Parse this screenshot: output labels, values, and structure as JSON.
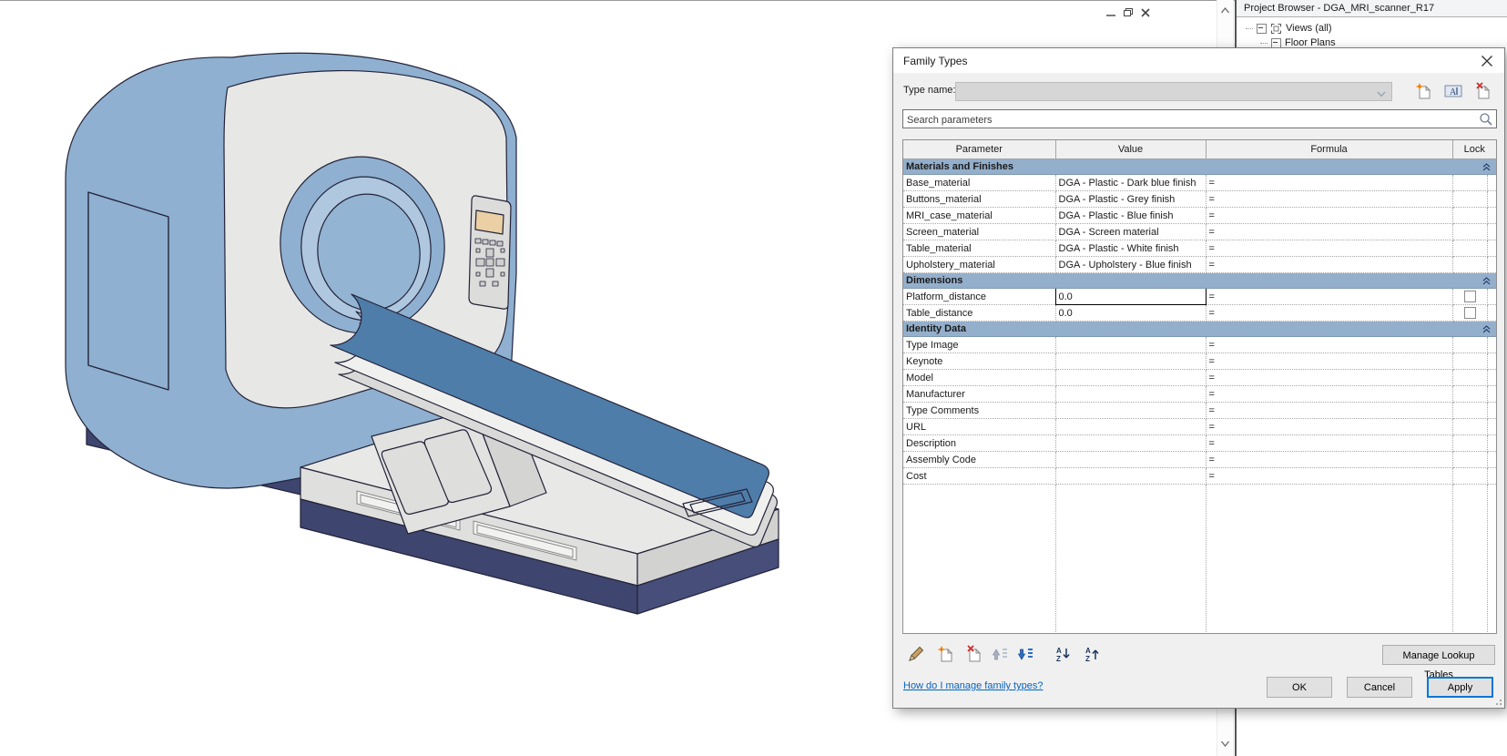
{
  "window_controls": {
    "buttons": [
      "minimize",
      "restore",
      "close"
    ]
  },
  "project_browser": {
    "title": "Project Browser - DGA_MRI_scanner_R17",
    "items": [
      {
        "label": "Views (all)",
        "level": 0,
        "icon": "views-icon",
        "expand": "expanded"
      },
      {
        "label": "Floor Plans",
        "level": 1,
        "icon": null,
        "expand": "expanded"
      }
    ]
  },
  "family_types_dialog": {
    "title": "Family Types",
    "type_name": {
      "label": "Type name:",
      "value": ""
    },
    "type_actions": [
      "new-type",
      "rename-type",
      "delete-type"
    ],
    "search": {
      "placeholder": "Search parameters"
    },
    "table": {
      "columns": [
        "Parameter",
        "Value",
        "Formula",
        "Lock"
      ],
      "groups": [
        {
          "name": "Materials and Finishes",
          "rows": [
            {
              "parameter": "Base_material",
              "value": "DGA - Plastic - Dark blue finish",
              "formula": "="
            },
            {
              "parameter": "Buttons_material",
              "value": "DGA - Plastic - Grey finish",
              "formula": "="
            },
            {
              "parameter": "MRI_case_material",
              "value": "DGA - Plastic - Blue finish",
              "formula": "="
            },
            {
              "parameter": "Screen_material",
              "value": "DGA - Screen material",
              "formula": "="
            },
            {
              "parameter": "Table_material",
              "value": "DGA - Plastic - White finish",
              "formula": "="
            },
            {
              "parameter": "Upholstery_material",
              "value": "DGA - Upholstery - Blue finish",
              "formula": "="
            }
          ]
        },
        {
          "name": "Dimensions",
          "rows": [
            {
              "parameter": "Platform_distance",
              "value": "0.0",
              "formula": "=",
              "lock": "unchecked",
              "editing": true
            },
            {
              "parameter": "Table_distance",
              "value": "0.0",
              "formula": "=",
              "lock": "unchecked"
            }
          ]
        },
        {
          "name": "Identity Data",
          "rows": [
            {
              "parameter": "Type Image",
              "value": "",
              "formula": "="
            },
            {
              "parameter": "Keynote",
              "value": "",
              "formula": "="
            },
            {
              "parameter": "Model",
              "value": "",
              "formula": "="
            },
            {
              "parameter": "Manufacturer",
              "value": "",
              "formula": "="
            },
            {
              "parameter": "Type Comments",
              "value": "",
              "formula": "="
            },
            {
              "parameter": "URL",
              "value": "",
              "formula": "="
            },
            {
              "parameter": "Description",
              "value": "",
              "formula": "="
            },
            {
              "parameter": "Assembly Code",
              "value": "",
              "formula": "="
            },
            {
              "parameter": "Cost",
              "value": "",
              "formula": "="
            }
          ]
        }
      ]
    },
    "toolbar_icons": [
      "edit-parameter",
      "new-parameter",
      "delete-parameter",
      "move-up",
      "move-down",
      "sort-ascending",
      "sort-descending"
    ],
    "footer": {
      "manage_lookup_tables": "Manage Lookup Tables",
      "help_link": "How do I manage family types?",
      "ok": "OK",
      "cancel": "Cancel",
      "apply": "Apply"
    }
  },
  "illustration": {
    "subject": "MRI scanner with patient table, isometric line drawing",
    "colors": {
      "gantry_blue": "#8FB0D0",
      "case_grey": "#E7E7E5",
      "base_navy": "#3F466F",
      "base_navy_light": "#4A5180",
      "bed_blue": "#4F7DA9",
      "platform_grey": "#E6E6E4",
      "screen_tan": "#EBCFA5",
      "outline": "#23233A"
    }
  }
}
